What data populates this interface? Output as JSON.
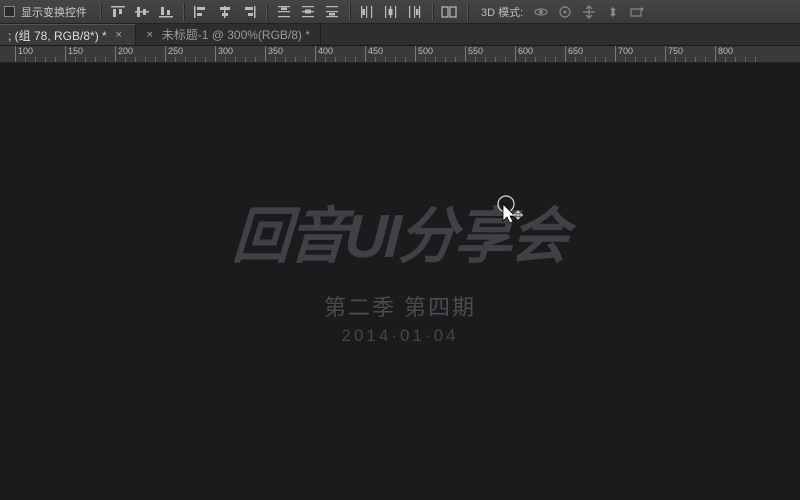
{
  "options_bar": {
    "show_transform_label": "显示变换控件",
    "mode3d_label": "3D 模式:"
  },
  "tabs": [
    {
      "title": "; (组 78, RGB/8*) *",
      "active": true
    },
    {
      "title": "未标题-1 @ 300%(RGB/8) *",
      "active": false
    }
  ],
  "ruler": {
    "majors": [
      100,
      150,
      200,
      250,
      300,
      350,
      400,
      450,
      500,
      550,
      600,
      650,
      700,
      750,
      800
    ]
  },
  "canvas": {
    "title": "回音UI分享会",
    "subtitle": "第二季 第四期",
    "date": "2014·01·04"
  }
}
